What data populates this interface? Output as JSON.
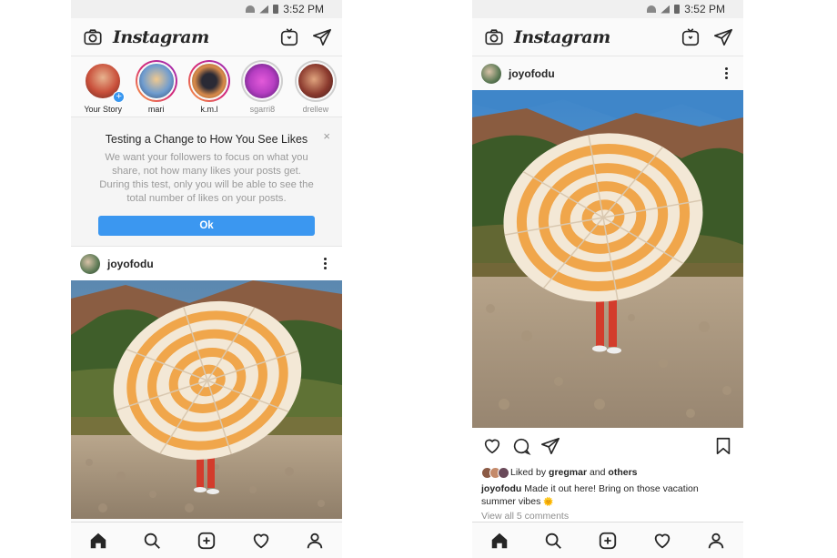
{
  "status": {
    "time": "3:52 PM"
  },
  "app": {
    "logo": "Instagram"
  },
  "stories": [
    {
      "name": "Your Story",
      "seen": false,
      "own": true,
      "color": "#c9503b"
    },
    {
      "name": "mari",
      "seen": false,
      "own": false,
      "color": "#6f9ccf"
    },
    {
      "name": "k.m.l",
      "seen": false,
      "own": false,
      "color": "#4a4a5a"
    },
    {
      "name": "sgarri8",
      "seen": true,
      "own": false,
      "color": "#b63ec2"
    },
    {
      "name": "drellew",
      "seen": true,
      "own": false,
      "color": "#8b3a2e"
    }
  ],
  "notice": {
    "title": "Testing a Change to How You See Likes",
    "body": "We want your followers to focus on what you share, not how many likes your posts get. During this test, only you will be able to see the total number of likes on your posts.",
    "close": "×",
    "ok_label": "Ok"
  },
  "post": {
    "username": "joyofodu",
    "liked_by_prefix": "Liked by",
    "liked_by_user": "gregmar",
    "liked_by_and": "and",
    "liked_by_others": "others",
    "caption_user": "joyofodu",
    "caption_text": "Made it out here! Bring on those vacation summer vibes",
    "caption_emoji": "🌞",
    "view_comments": "View all 5 comments"
  },
  "icons": {
    "camera": "camera-icon",
    "igtv": "igtv-icon",
    "direct": "direct-message-icon",
    "home": "home-icon",
    "search": "search-icon",
    "add": "add-post-icon",
    "activity": "heart-icon",
    "profile": "profile-icon",
    "like": "heart-icon",
    "comment": "comment-icon",
    "share": "share-icon",
    "save": "bookmark-icon"
  }
}
